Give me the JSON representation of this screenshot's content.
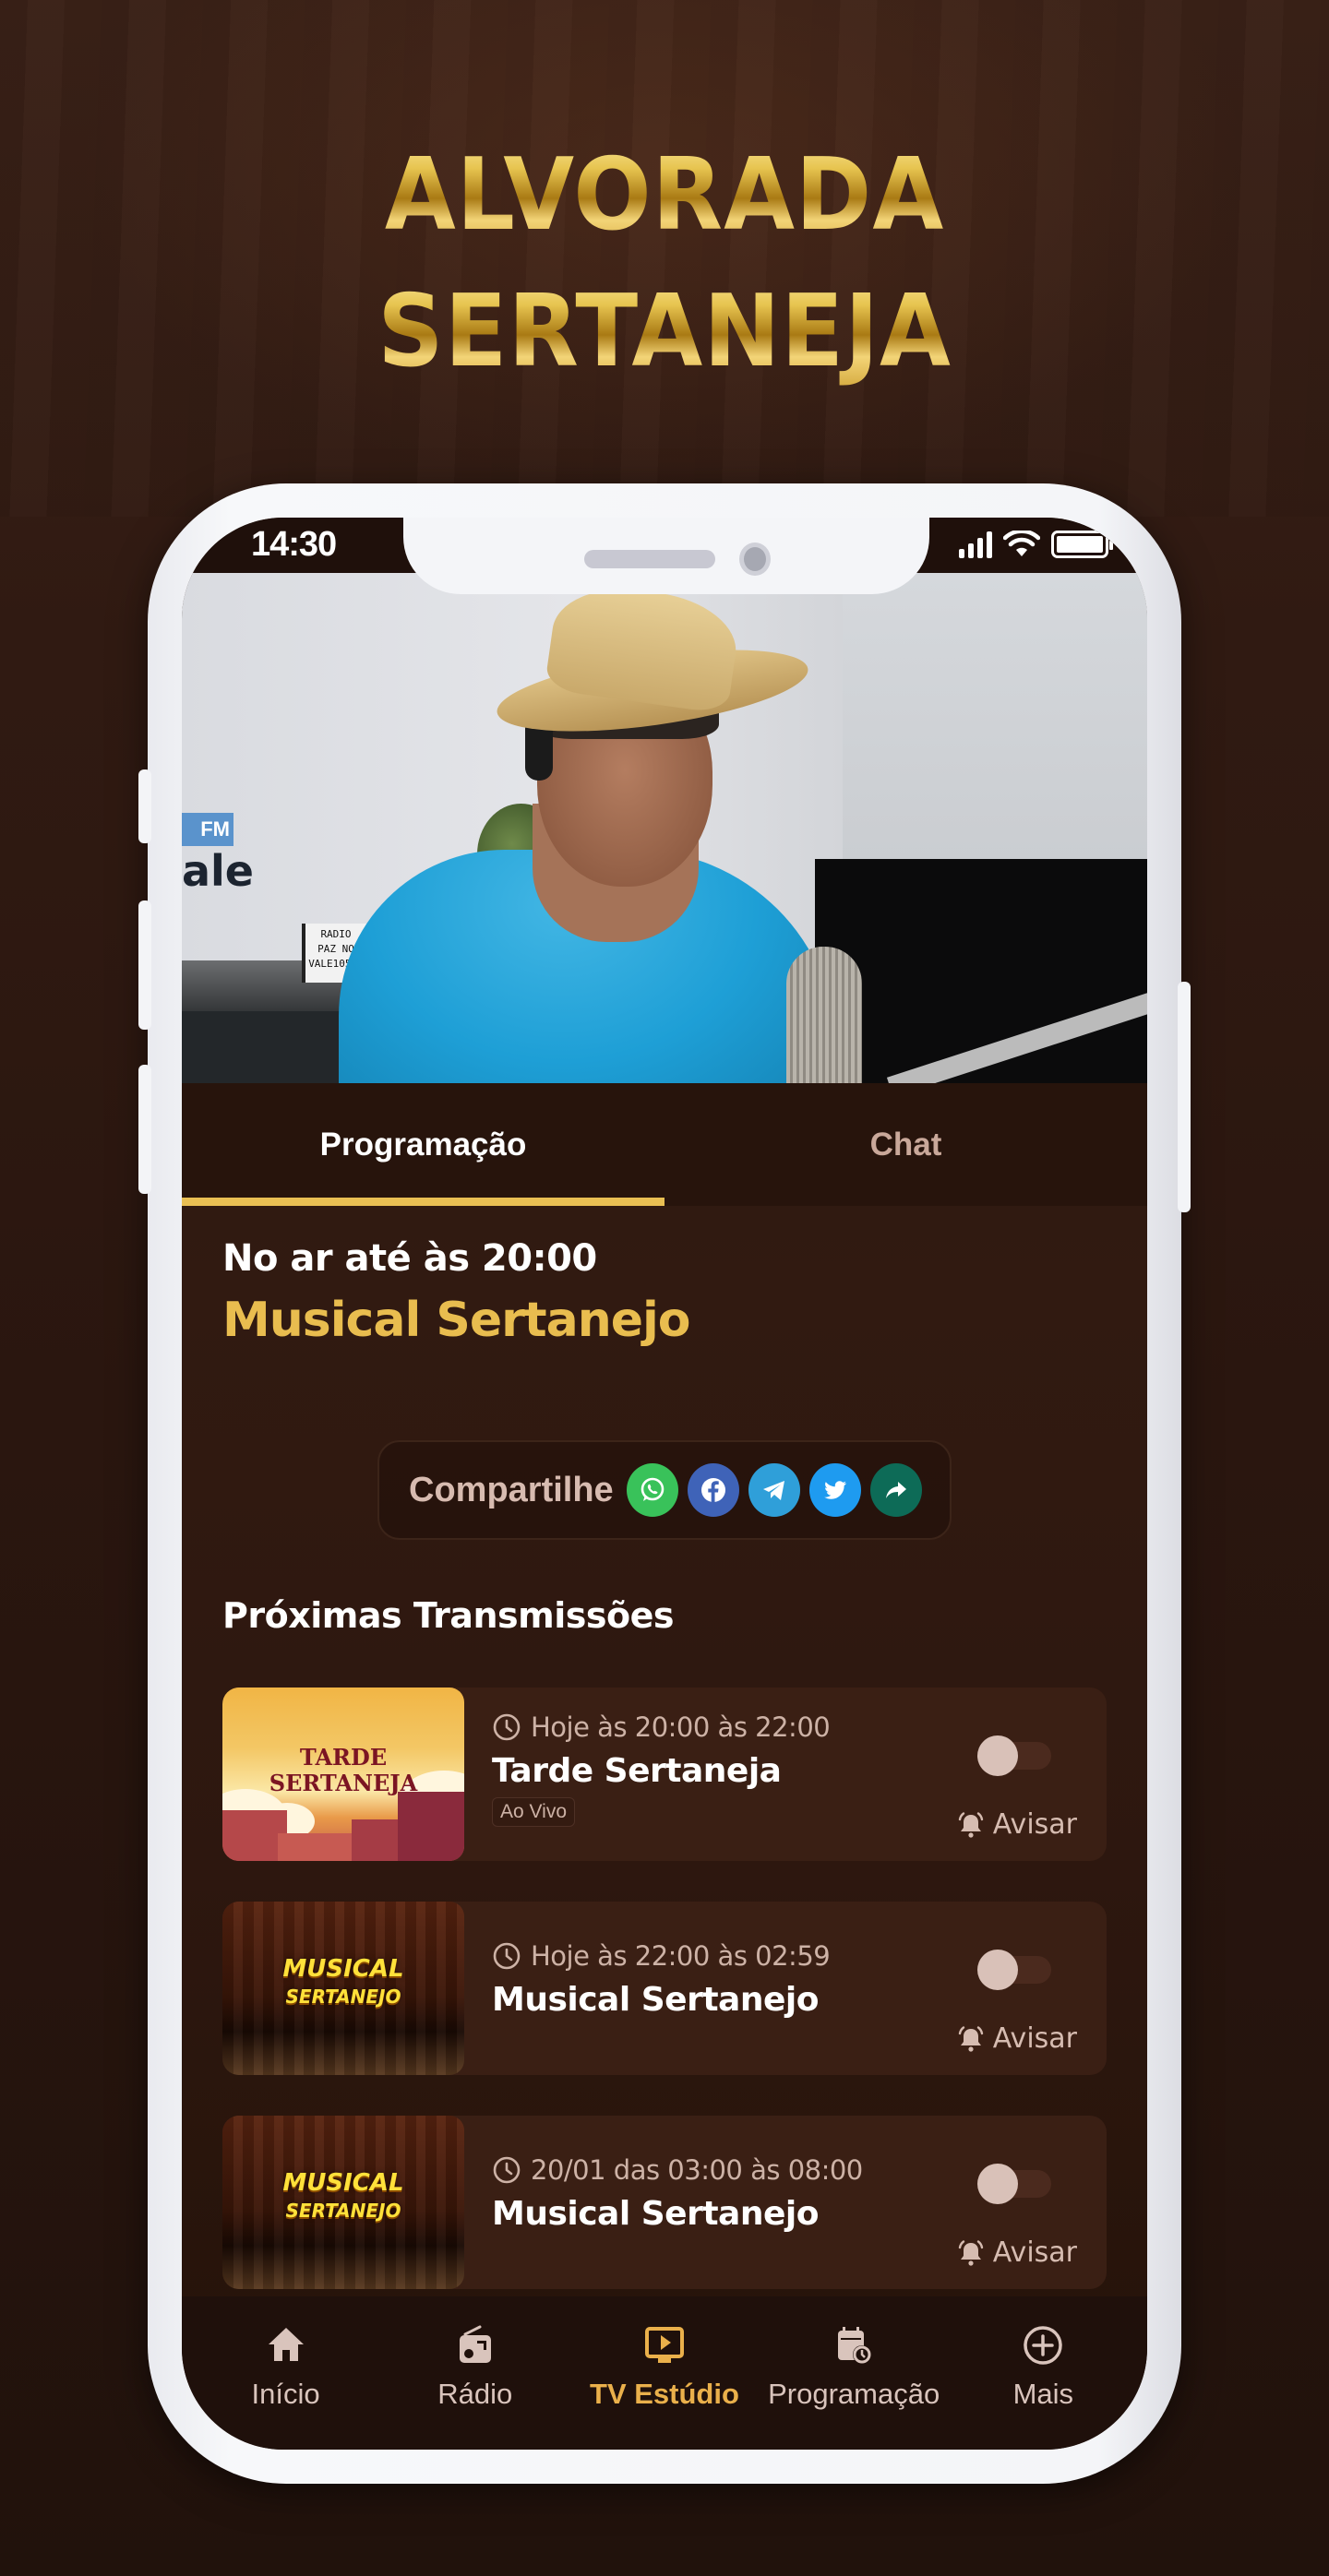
{
  "brand": {
    "line1": "ALVORADA",
    "line2": "SERTANEJA"
  },
  "status_bar": {
    "time": "14:30",
    "signal_bars": 4,
    "battery": "full"
  },
  "video": {
    "studio_sign_fm": "FM",
    "studio_sign_name": "ale",
    "lightbox_text": [
      "RADIO",
      "PAZ NO",
      "VALE105.9"
    ]
  },
  "tabs": [
    {
      "label": "Programação",
      "active": true
    },
    {
      "label": "Chat",
      "active": false
    }
  ],
  "now_playing": {
    "until": "No ar até às 20:00",
    "title": "Musical Sertanejo"
  },
  "share": {
    "label": "Compartilhe",
    "buttons": [
      {
        "name": "whatsapp",
        "icon": "whatsapp-icon",
        "color": "#39c25a"
      },
      {
        "name": "facebook",
        "icon": "facebook-icon",
        "color": "#3f63b8"
      },
      {
        "name": "telegram",
        "icon": "telegram-icon",
        "color": "#2f9fd9"
      },
      {
        "name": "twitter",
        "icon": "twitter-icon",
        "color": "#1e9bf0"
      },
      {
        "name": "share",
        "icon": "share-arrow-icon",
        "color": "#0d6b57"
      }
    ]
  },
  "upcoming": {
    "title": "Próximas Transmissões",
    "items": [
      {
        "time": "Hoje às 20:00 às 22:00",
        "title": "Tarde Sertaneja",
        "badge": "Ao Vivo",
        "thumb_text_1": "TARDE",
        "thumb_text_2": "SERTANEJA",
        "notify_on": false,
        "notify_label": "Avisar"
      },
      {
        "time": "Hoje às 22:00 às 02:59",
        "title": "Musical Sertanejo",
        "badge": null,
        "thumb_text_1": "MUSICAL",
        "thumb_text_2": "SERTANEJO",
        "notify_on": false,
        "notify_label": "Avisar"
      },
      {
        "time": "20/01 das 03:00 às 08:00",
        "title": "Musical Sertanejo",
        "badge": null,
        "thumb_text_1": "MUSICAL",
        "thumb_text_2": "SERTANEJO",
        "notify_on": false,
        "notify_label": "Avisar"
      }
    ]
  },
  "bottom_nav": [
    {
      "label": "Início",
      "icon": "home-icon",
      "active": false
    },
    {
      "label": "Rádio",
      "icon": "radio-icon",
      "active": false
    },
    {
      "label": "TV Estúdio",
      "icon": "tv-play-icon",
      "active": true
    },
    {
      "label": "Programação",
      "icon": "calendar-clock-icon",
      "active": false
    },
    {
      "label": "Mais",
      "icon": "plus-circle-icon",
      "active": false
    }
  ],
  "colors": {
    "accent_gold": "#e9bd4f",
    "nav_active": "#eab04b",
    "background": "#2a160f"
  }
}
